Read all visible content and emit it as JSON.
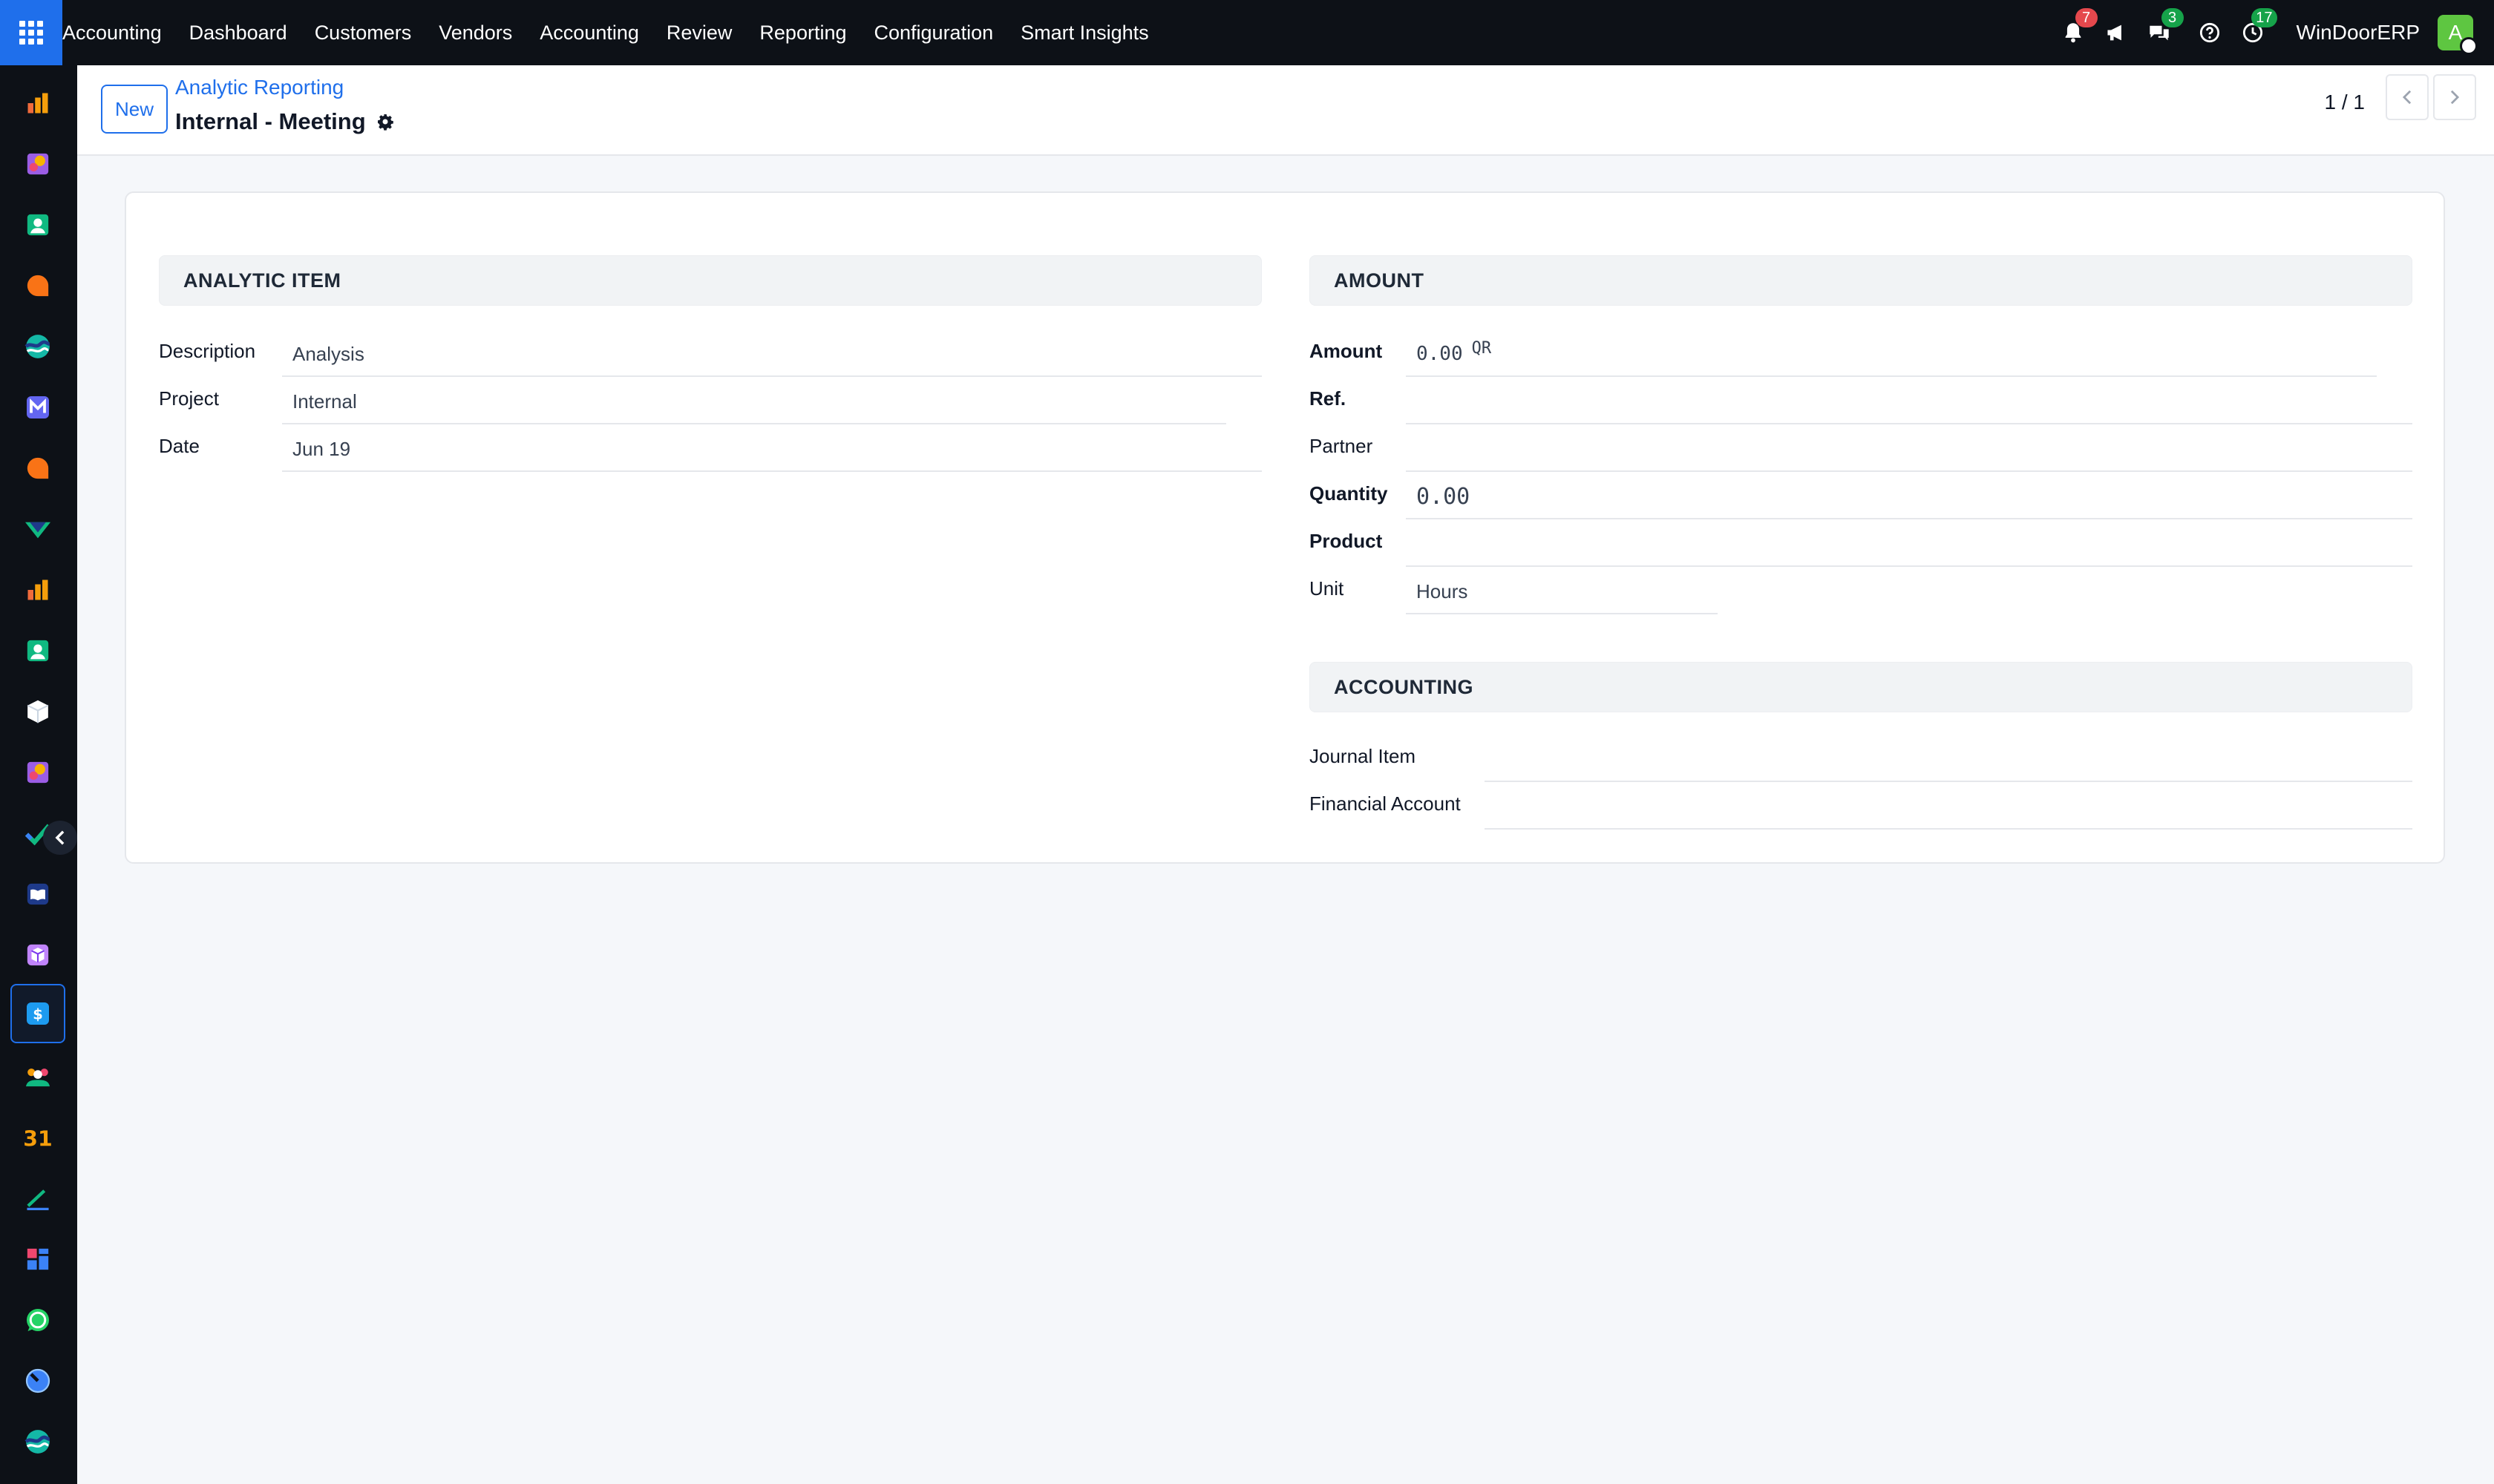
{
  "topbar": {
    "menu": [
      "Accounting",
      "Dashboard",
      "Customers",
      "Vendors",
      "Accounting",
      "Review",
      "Reporting",
      "Configuration",
      "Smart Insights"
    ],
    "notifications_count": "7",
    "messages_count": "3",
    "activities_count": "17",
    "company": "WinDoorERP",
    "avatar_initial": "A"
  },
  "control": {
    "new_label": "New",
    "breadcrumb": "Analytic Reporting",
    "title": "Internal - Meeting",
    "pager": "1 / 1"
  },
  "form": {
    "analytic_item": {
      "heading": "ANALYTIC ITEM",
      "description_label": "Description",
      "description_value": "Analysis",
      "project_label": "Project",
      "project_value": "Internal",
      "date_label": "Date",
      "date_value": "Jun 19"
    },
    "amount": {
      "heading": "AMOUNT",
      "amount_label": "Amount",
      "amount_value": "0.00",
      "currency": "QR",
      "ref_label": "Ref.",
      "partner_label": "Partner",
      "quantity_label": "Quantity",
      "quantity_value": "0.00",
      "product_label": "Product",
      "unit_label": "Unit",
      "unit_value": "Hours"
    },
    "accounting": {
      "heading": "ACCOUNTING",
      "journal_item_label": "Journal Item",
      "financial_account_label": "Financial Account"
    }
  },
  "colors": {
    "topbar": "#0d1117",
    "accent": "#1f6feb",
    "badge_red": "#e5484d",
    "badge_green": "#16a34a",
    "avatar": "#5ec641"
  },
  "sidebar_apps": [
    "chart-app-icon",
    "puzzle-app-icon",
    "contacts-app-icon",
    "chat-app-icon",
    "wave-app-icon",
    "mail-app-icon",
    "discuss-app-icon",
    "check-app-icon",
    "chart-app-icon",
    "contacts-app-icon",
    "cube-app-icon",
    "puzzle-app-icon",
    "todo-app-icon",
    "book-app-icon",
    "box-app-icon",
    "accounting-app-icon",
    "team-app-icon",
    "calendar-app-icon",
    "sign-app-icon",
    "dashboard-app-icon",
    "whatsapp-app-icon",
    "planning-app-icon",
    "wave-app-icon"
  ]
}
